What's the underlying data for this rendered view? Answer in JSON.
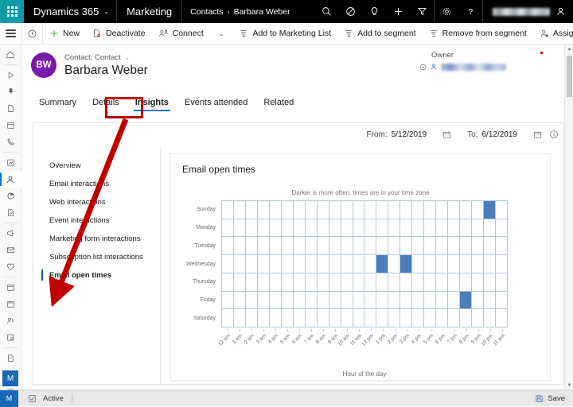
{
  "topbar": {
    "waffle_icon": "app-launcher-icon",
    "brand": "Dynamics 365",
    "brand_chevron": "⌄",
    "app_name": "Marketing",
    "breadcrumb": {
      "parent": "Contacts",
      "separator": "›",
      "current": "Barbara Weber"
    },
    "icons": [
      "search-icon",
      "assistant-icon",
      "ideas-icon",
      "quick-create-icon",
      "filter-icon",
      "settings-icon",
      "help-icon"
    ],
    "user_name_blurred": ""
  },
  "commandbar": {
    "menu_icon": "hamburger-icon",
    "recent_icon": "recent-clock-icon",
    "items": [
      {
        "label": "New",
        "icon": "plus-icon"
      },
      {
        "label": "Deactivate",
        "icon": "deactivate-icon"
      },
      {
        "label": "Connect",
        "icon": "connect-icon"
      }
    ],
    "caret": "⌄",
    "items2": [
      {
        "label": "Add to Marketing List",
        "icon": "add-to-list-icon"
      },
      {
        "label": "Add to segment",
        "icon": "add-to-segment-icon"
      },
      {
        "label": "Remove from segment",
        "icon": "remove-from-segment-icon"
      },
      {
        "label": "Assign",
        "icon": "assign-icon"
      }
    ],
    "overflow": "···"
  },
  "rail": {
    "icons": [
      "home-icon",
      "recent-icon",
      "pinned-icon",
      "document-icon",
      "calendar-icon",
      "phone-icon",
      "dashboard-icon",
      "contacts-icon",
      "segments-icon",
      "lead-icon",
      "marketing-email-icon",
      "email-icon",
      "customer-journey-icon",
      "event-icon",
      "session-icon",
      "speaker-icon",
      "form-icon",
      "page-icon",
      "survey-icon",
      "template-icon"
    ],
    "selected_index": 7,
    "avatar_initial": "M"
  },
  "record": {
    "avatar_initials": "BW",
    "type_label": "Contact: Contact",
    "type_chevron": "⌄",
    "name": "Barbara Weber",
    "owner_label": "Owner",
    "owner_lookup_icon": "lookup-icon",
    "owner_person_icon": "person-icon",
    "owner_value_blurred": ""
  },
  "tabs": [
    {
      "label": "Summary",
      "active": false
    },
    {
      "label": "Details",
      "active": false
    },
    {
      "label": "Insights",
      "active": true
    },
    {
      "label": "Events attended",
      "active": false
    },
    {
      "label": "Related",
      "active": false
    }
  ],
  "daterange": {
    "from_label": "From:",
    "from_value": "5/12/2019",
    "to_label": "To:",
    "to_value": "6/12/2019",
    "calendar_icon": "calendar-icon",
    "info_icon": "info-icon"
  },
  "insights_nav": [
    {
      "label": "Overview",
      "selected": false
    },
    {
      "label": "Email interactions",
      "selected": false
    },
    {
      "label": "Web interactions",
      "selected": false
    },
    {
      "label": "Event interactions",
      "selected": false
    },
    {
      "label": "Marketing form interactions",
      "selected": false
    },
    {
      "label": "Subscription list interactions",
      "selected": false
    },
    {
      "label": "Email open times",
      "selected": true
    }
  ],
  "statusbar": {
    "app_initial": "M",
    "state_icon": "record-state-icon",
    "state_label": "Active",
    "save_icon": "save-icon",
    "save_label": "Save"
  },
  "colors": {
    "accent_blue": "#0078d4",
    "brand_teal": "#0f9ba8",
    "avatar_purple": "#7719aa",
    "heat_fill": "#4a7ebb",
    "grid_line": "#b2c7e4",
    "annotation_red": "#c00000"
  },
  "chart_data": {
    "type": "heatmap",
    "title": "Email open times",
    "subtitle": "Darker is more often, times are in your time zone",
    "xlabel": "Hour of the day",
    "ylabel": "",
    "grid": true,
    "legend": "none",
    "categories_y": [
      "Sunday",
      "Monday",
      "Tuesday",
      "Wednesday",
      "Thursday",
      "Friday",
      "Saturday"
    ],
    "categories_x": [
      "12 am",
      "1 am",
      "2 am",
      "3 am",
      "4 am",
      "5 am",
      "6 am",
      "7 am",
      "8 am",
      "9 am",
      "10 am",
      "11 am",
      "12 pm",
      "1 pm",
      "2 pm",
      "3 pm",
      "4 pm",
      "5 pm",
      "6 pm",
      "7 pm",
      "8 pm",
      "9 pm",
      "10 pm",
      "11 pm"
    ],
    "values": [
      [
        0,
        0,
        0,
        0,
        0,
        0,
        0,
        0,
        0,
        0,
        0,
        0,
        0,
        0,
        0,
        0,
        0,
        0,
        0,
        0,
        0,
        0,
        1,
        0
      ],
      [
        0,
        0,
        0,
        0,
        0,
        0,
        0,
        0,
        0,
        0,
        0,
        0,
        0,
        0,
        0,
        0,
        0,
        0,
        0,
        0,
        0,
        0,
        0,
        0
      ],
      [
        0,
        0,
        0,
        0,
        0,
        0,
        0,
        0,
        0,
        0,
        0,
        0,
        0,
        0,
        0,
        0,
        0,
        0,
        0,
        0,
        0,
        0,
        0,
        0
      ],
      [
        0,
        0,
        0,
        0,
        0,
        0,
        0,
        0,
        0,
        0,
        0,
        0,
        0,
        1,
        0,
        1,
        0,
        0,
        0,
        0,
        0,
        0,
        0,
        0
      ],
      [
        0,
        0,
        0,
        0,
        0,
        0,
        0,
        0,
        0,
        0,
        0,
        0,
        0,
        0,
        0,
        0,
        0,
        0,
        0,
        0,
        0,
        0,
        0,
        0
      ],
      [
        0,
        0,
        0,
        0,
        0,
        0,
        0,
        0,
        0,
        0,
        0,
        0,
        0,
        0,
        0,
        0,
        0,
        0,
        0,
        0,
        1,
        0,
        0,
        0
      ],
      [
        0,
        0,
        0,
        0,
        0,
        0,
        0,
        0,
        0,
        0,
        0,
        0,
        0,
        0,
        0,
        0,
        0,
        0,
        0,
        0,
        0,
        0,
        0,
        0
      ]
    ],
    "highlighted_cells": [
      {
        "day": "Sunday",
        "hour": "10 pm"
      },
      {
        "day": "Wednesday",
        "hour": "1 pm"
      },
      {
        "day": "Wednesday",
        "hour": "3 pm"
      },
      {
        "day": "Friday",
        "hour": "8 pm"
      }
    ]
  }
}
